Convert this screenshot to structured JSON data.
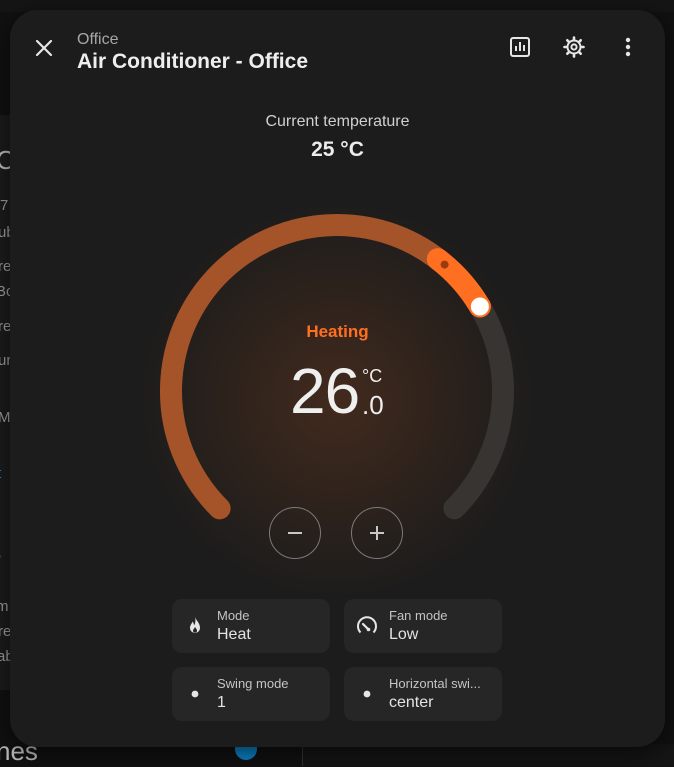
{
  "background_page": {
    "fragments": [
      "C",
      "7",
      "ub",
      "re",
      "Bc",
      "re",
      "ur",
      "M",
      "t",
      "r",
      "m",
      "re",
      "ab"
    ],
    "bottom_title": "nes"
  },
  "header": {
    "breadcrumb": "Office",
    "title": "Air Conditioner - Office",
    "icons": [
      "close-icon",
      "history-chart-icon",
      "settings-gear-icon",
      "more-vertical-icon"
    ]
  },
  "current": {
    "label": "Current temperature",
    "value": "25 °C"
  },
  "thermostat": {
    "action": "Heating",
    "target_integer": "26",
    "target_decimal": ".0",
    "unit": "°C",
    "target_fraction": 0.72,
    "accent_color": "#ff6f22",
    "track_color": "#383432",
    "decrease_icon": "minus-icon",
    "increase_icon": "plus-icon"
  },
  "features": [
    {
      "label": "Mode",
      "value": "Heat",
      "icon": "fire-icon"
    },
    {
      "label": "Fan mode",
      "value": "Low",
      "icon": "fan-speed-icon"
    },
    {
      "label": "Swing mode",
      "value": "1",
      "icon": "dot-icon"
    },
    {
      "label": "Horizontal swi...",
      "value": "center",
      "icon": "dot-icon"
    }
  ]
}
